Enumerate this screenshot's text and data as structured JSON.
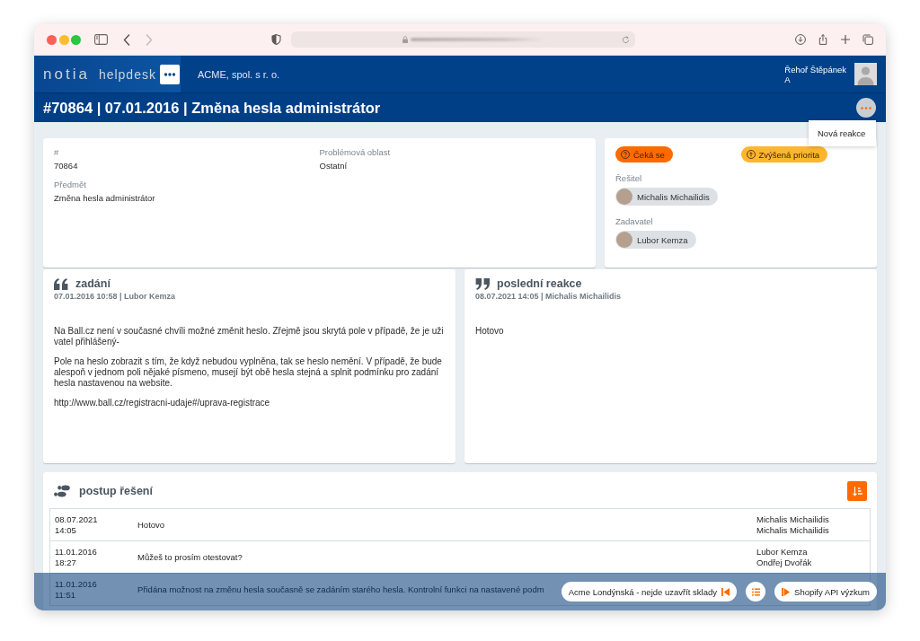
{
  "browser": {
    "nav": [
      {
        "kind": "back",
        "disabled": false
      },
      {
        "kind": "forward",
        "disabled": true
      }
    ]
  },
  "header": {
    "logo": "notia",
    "product": "helpdesk",
    "company": "ACME, spol. s r. o.",
    "user": {
      "name": "Řehoř Štěpánek",
      "role": "A"
    }
  },
  "title_bar": {
    "title": "#70864 | 07.01.2016 | Změna hesla administrátor",
    "menu": {
      "expanded": true,
      "items": [
        {
          "label": "Nová reakce"
        }
      ]
    }
  },
  "details": {
    "fields": [
      {
        "label": "#",
        "value": "70864"
      },
      {
        "label": "Problémová oblast",
        "value": "Ostatní"
      },
      {
        "label": "Předmět",
        "value": "Změna hesla administrátor"
      }
    ]
  },
  "status": {
    "badges": [
      {
        "kind": "waiting",
        "label": "Čeká se",
        "color": "#ff6a00"
      },
      {
        "kind": "priority",
        "label": "Zvýšená priorita",
        "color": "#ffb62e"
      }
    ],
    "people": [
      {
        "label": "Řešitel",
        "name": "Michalis Michailidis"
      },
      {
        "label": "Zadavatel",
        "name": "Lubor Kemza"
      }
    ]
  },
  "messages": [
    {
      "kind": "opening",
      "title": "zadání",
      "meta": "07.01.2016 10:58 | Lubor Kemza",
      "paragraphs": [
        "Na Ball.cz není v současné chvíli možné změnit heslo. Zřejmě jsou skrytá pole v případě, že je uživatel přihlášený-",
        "Pole na heslo zobrazit s tím, že když nebudou vyplněna, tak se heslo nemění. V případě, že bude alespoň v jednom poli nějaké písmeno, musejí být obě hesla stejná a splnit podmínku pro zadání hesla nastavenou na website.",
        "http://www.ball.cz/registracni-udaje#/uprava-registrace"
      ]
    },
    {
      "kind": "closing",
      "title": "poslední reakce",
      "meta": "08.07.2021 14:05 | Michalis Michailidis",
      "paragraphs": [
        "Hotovo"
      ]
    }
  ],
  "progress": {
    "title": "postup řešení",
    "rows": [
      {
        "date": "08.07.2021",
        "time": "14:05",
        "text": "Hotovo",
        "names": [
          "Michalis Michailidis",
          "Michalis Michailidis"
        ]
      },
      {
        "date": "11.01.2016",
        "time": "18:27",
        "text": "Můžeš to prosím otestovat?",
        "names": [
          "Lubor Kemza",
          "Ondřej Dvořák"
        ]
      },
      {
        "date": "11.01.2016",
        "time": "11:51",
        "text": "Přidána možnost na změnu hesla současně se zadáním starého hesla. Kontrolní funkci na nastavené podm"
      }
    ]
  },
  "bottom_bar": {
    "items": [
      {
        "kind": "previous",
        "label": "Acme Londýnská - nejde uzavřít sklady"
      },
      {
        "kind": "list"
      },
      {
        "kind": "next",
        "label": "Shopify API výzkum"
      }
    ]
  }
}
